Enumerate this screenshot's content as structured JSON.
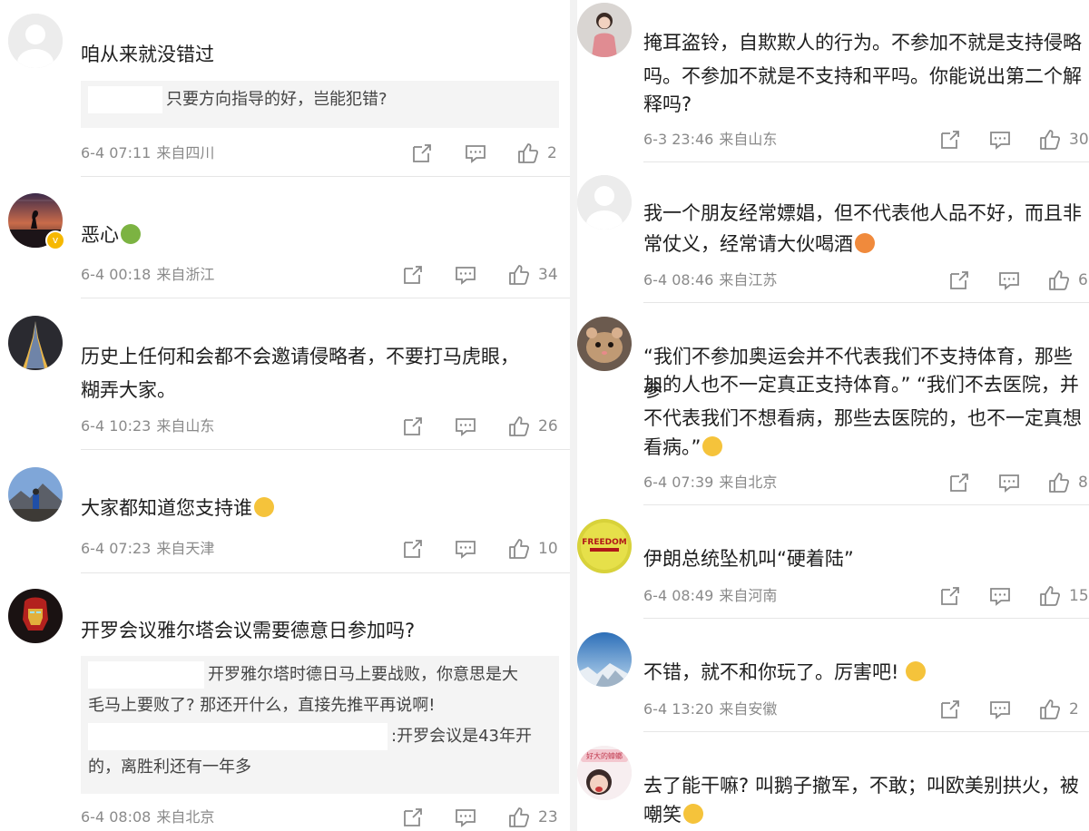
{
  "left_column": [
    {
      "text": "咱从来就没错过",
      "quote": "只要方向指导的好，岂能犯错?",
      "date": "6-4 07:11",
      "location": "来自四川",
      "likes": "2",
      "avatar": "default-avatar"
    },
    {
      "text": "恶心",
      "date": "6-4 00:18",
      "location": "来自浙江",
      "likes": "34",
      "avatar": "sunset-silhouette-avatar"
    },
    {
      "text_line1": "历史上任何和会都不会邀请侵略者，不要打马虎眼，",
      "text_line2": "糊弄大家。",
      "date": "6-4 10:23",
      "location": "来自山东",
      "likes": "26",
      "avatar": "eiffel-tower-avatar"
    },
    {
      "text": "大家都知道您支持谁",
      "date": "6-4 07:23",
      "location": "来自天津",
      "likes": "10",
      "avatar": "mountain-person-avatar"
    },
    {
      "text": "开罗会议雅尔塔会议需要德意日参加吗?",
      "reply1_line1": "开罗雅尔塔时德日马上要战败，你意思是大",
      "reply1_line2": "毛马上要败了? 那还开什么，直接先推平再说啊!",
      "reply2_line1": ":开罗会议是43年开",
      "reply2_line2": "的，离胜利还有一年多",
      "date": "6-4 08:08",
      "location": "来自北京",
      "likes": "23",
      "avatar": "iron-man-avatar"
    }
  ],
  "right_column": [
    {
      "text_line1": "掩耳盗铃，自欺欺人的行为。不参加不就是支持侵略",
      "text_line2": "吗。不参加不就是不支持和平吗。你能说出第二个解",
      "text_line3": "释吗?",
      "date": "6-3 23:46",
      "location": "来自山东",
      "likes": "30",
      "avatar": "woman-photo-avatar"
    },
    {
      "text_line1": "我一个朋友经常嫖娼，但不代表他人品不好，而且非",
      "text_line2": "常仗义，经常请大伙喝酒",
      "date": "6-4 08:46",
      "location": "来自江苏",
      "likes": "6",
      "avatar": "default-avatar"
    },
    {
      "text_line1": "“我们不参加奥运会并不代表我们不支持体育，那些参",
      "text_line2": "加的人也不一定真正支持体育。” “我们不去医院，并",
      "text_line3": "不代表我们不想看病，那些去医院的，也不一定真想",
      "text_line4": "看病。”",
      "date": "6-4 07:39",
      "location": "来自北京",
      "likes": "8",
      "avatar": "hamster-avatar"
    },
    {
      "text": "伊朗总统坠机叫“硬着陆”",
      "date": "6-4 08:49",
      "location": "来自河南",
      "likes": "15",
      "avatar": "freedom-logo-avatar",
      "avatar_text": "FREEDOM"
    },
    {
      "text": "不错，就不和你玩了。厉害吧!",
      "date": "6-4 13:20",
      "location": "来自安徽",
      "likes": "2",
      "avatar": "sky-avatar"
    },
    {
      "text_line1": "去了能干嘛? 叫鹅子撤军，不敢；叫欧美别拱火，被",
      "text_line2": "嘲笑",
      "avatar": "cartoon-girl-avatar",
      "avatar_text": "好大的蟑螂"
    }
  ],
  "colors": {
    "text": "#1e1e1e",
    "meta": "#8a8a8a",
    "quote_bg": "#f4f4f4",
    "divider": "#e6e6e6",
    "badge": "#f6b800"
  }
}
